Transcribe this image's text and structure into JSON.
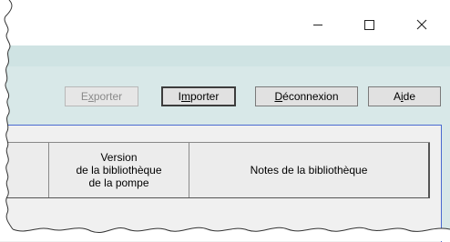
{
  "window": {
    "controls": {
      "minimize_icon": "minimize-icon",
      "maximize_icon": "maximize-icon",
      "close_icon": "close-icon"
    }
  },
  "toolbar": {
    "export_prefix": "E",
    "export_mnemonic": "x",
    "export_suffix": "porter",
    "import_prefix": "I",
    "import_mnemonic": "m",
    "import_suffix": "porter",
    "logout_prefix": "",
    "logout_mnemonic": "D",
    "logout_suffix": "éconnexion",
    "help_prefix": "A",
    "help_mnemonic": "i",
    "help_suffix": "de"
  },
  "table": {
    "columns": [
      {
        "label": ""
      },
      {
        "label_lines": [
          "Version",
          "de la bibliothèque",
          "de la pompe"
        ]
      },
      {
        "label": "Notes de la bibliothèque"
      }
    ]
  },
  "colors": {
    "menubar": "#cfe3e3",
    "toolbar": "#d8e8e8",
    "panel_border": "#4a6ad0"
  }
}
